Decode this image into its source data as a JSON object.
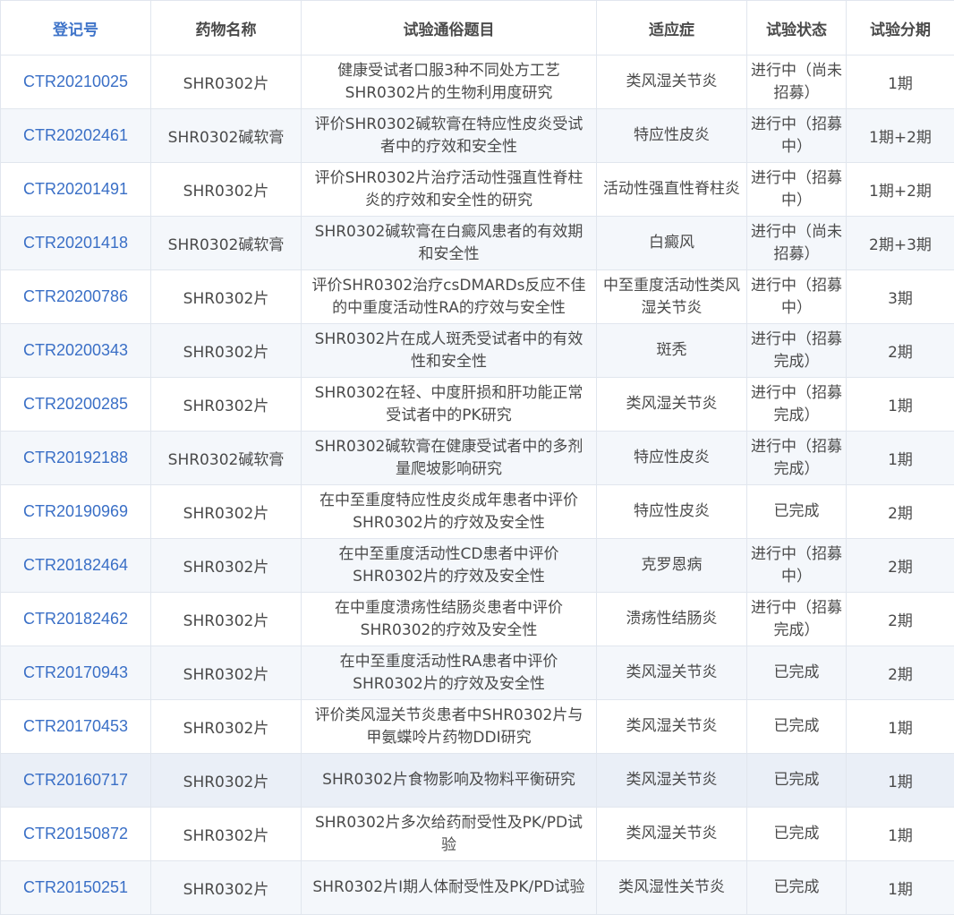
{
  "header": {
    "reg_no": "登记号",
    "drug": "药物名称",
    "title": "试验通俗题目",
    "indication": "适应症",
    "status": "试验状态",
    "phase": "试验分期"
  },
  "rows": [
    {
      "reg": "CTR20210025",
      "drug": "SHR0302片",
      "title": "健康受试者口服3种不同处方工艺SHR0302片的生物利用度研究",
      "indication": "类风湿关节炎",
      "status": "进行中（尚未招募）",
      "phase": "1期"
    },
    {
      "reg": "CTR20202461",
      "drug": "SHR0302碱软膏",
      "title": "评价SHR0302碱软膏在特应性皮炎受试者中的疗效和安全性",
      "indication": "特应性皮炎",
      "status": "进行中（招募中）",
      "phase": "1期+2期"
    },
    {
      "reg": "CTR20201491",
      "drug": "SHR0302片",
      "title": "评价SHR0302片治疗活动性强直性脊柱炎的疗效和安全性的研究",
      "indication": "活动性强直性脊柱炎",
      "status": "进行中（招募中）",
      "phase": "1期+2期"
    },
    {
      "reg": "CTR20201418",
      "drug": "SHR0302碱软膏",
      "title": "SHR0302碱软膏在白癜风患者的有效期和安全性",
      "indication": "白癜风",
      "status": "进行中（尚未招募）",
      "phase": "2期+3期"
    },
    {
      "reg": "CTR20200786",
      "drug": "SHR0302片",
      "title": "评价SHR0302治疗csDMARDs反应不佳的中重度活动性RA的疗效与安全性",
      "indication": "中至重度活动性类风湿关节炎",
      "status": "进行中（招募中）",
      "phase": "3期"
    },
    {
      "reg": "CTR20200343",
      "drug": "SHR0302片",
      "title": "SHR0302片在成人斑秃受试者中的有效性和安全性",
      "indication": "斑秃",
      "status": "进行中（招募完成）",
      "phase": "2期"
    },
    {
      "reg": "CTR20200285",
      "drug": "SHR0302片",
      "title": "SHR0302在轻、中度肝损和肝功能正常受试者中的PK研究",
      "indication": "类风湿关节炎",
      "status": "进行中（招募完成）",
      "phase": "1期"
    },
    {
      "reg": "CTR20192188",
      "drug": "SHR0302碱软膏",
      "title": "SHR0302碱软膏在健康受试者中的多剂量爬坡影响研究",
      "indication": "特应性皮炎",
      "status": "进行中（招募完成）",
      "phase": "1期"
    },
    {
      "reg": "CTR20190969",
      "drug": "SHR0302片",
      "title": "在中至重度特应性皮炎成年患者中评价SHR0302片的疗效及安全性",
      "indication": "特应性皮炎",
      "status": "已完成",
      "phase": "2期"
    },
    {
      "reg": "CTR20182464",
      "drug": "SHR0302片",
      "title": "在中至重度活动性CD患者中评价SHR0302片的疗效及安全性",
      "indication": "克罗恩病",
      "status": "进行中（招募中）",
      "phase": "2期"
    },
    {
      "reg": "CTR20182462",
      "drug": "SHR0302片",
      "title": "在中重度溃疡性结肠炎患者中评价SHR0302的疗效及安全性",
      "indication": "溃疡性结肠炎",
      "status": "进行中（招募完成）",
      "phase": "2期"
    },
    {
      "reg": "CTR20170943",
      "drug": "SHR0302片",
      "title": "在中至重度活动性RA患者中评价SHR0302片的疗效及安全性",
      "indication": "类风湿关节炎",
      "status": "已完成",
      "phase": "2期"
    },
    {
      "reg": "CTR20170453",
      "drug": "SHR0302片",
      "title": "评价类风湿关节炎患者中SHR0302片与甲氨蝶呤片药物DDI研究",
      "indication": "类风湿关节炎",
      "status": "已完成",
      "phase": "1期"
    },
    {
      "reg": "CTR20160717",
      "drug": "SHR0302片",
      "title": "SHR0302片食物影响及物料平衡研究",
      "indication": "类风湿关节炎",
      "status": "已完成",
      "phase": "1期"
    },
    {
      "reg": "CTR20150872",
      "drug": "SHR0302片",
      "title": "SHR0302片多次给药耐受性及PK/PD试验",
      "indication": "类风湿关节炎",
      "status": "已完成",
      "phase": "1期"
    },
    {
      "reg": "CTR20150251",
      "drug": "SHR0302片",
      "title": "SHR0302片I期人体耐受性及PK/PD试验",
      "indication": "类风湿性关节炎",
      "status": "已完成",
      "phase": "1期"
    }
  ]
}
